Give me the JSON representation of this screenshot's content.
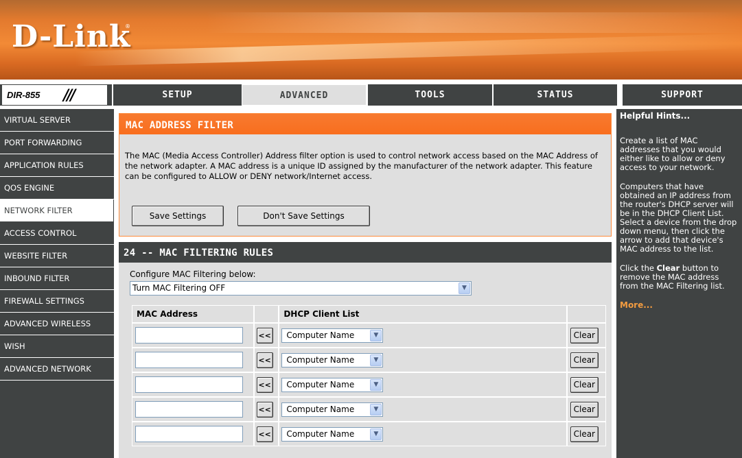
{
  "brand": {
    "logo": "D-Link",
    "registered_mark": "®",
    "model": "DIR-855",
    "model_slashes": "///"
  },
  "nav": {
    "tabs": [
      {
        "label": "SETUP"
      },
      {
        "label": "ADVANCED"
      },
      {
        "label": "TOOLS"
      },
      {
        "label": "STATUS"
      },
      {
        "label": "SUPPORT"
      }
    ],
    "active_tab": "ADVANCED"
  },
  "sidebar": {
    "items": [
      {
        "label": "VIRTUAL SERVER"
      },
      {
        "label": "PORT FORWARDING"
      },
      {
        "label": "APPLICATION RULES"
      },
      {
        "label": "QOS ENGINE"
      },
      {
        "label": "NETWORK FILTER"
      },
      {
        "label": "ACCESS CONTROL"
      },
      {
        "label": "WEBSITE FILTER"
      },
      {
        "label": "INBOUND FILTER"
      },
      {
        "label": "FIREWALL SETTINGS"
      },
      {
        "label": "ADVANCED WIRELESS"
      },
      {
        "label": "WISH"
      },
      {
        "label": "ADVANCED NETWORK"
      }
    ],
    "active_item": "NETWORK FILTER"
  },
  "filter": {
    "title": "MAC ADDRESS FILTER",
    "description": "The MAC (Media Access Controller) Address filter option is used to control network access based on the MAC Address of the network adapter. A MAC address is a unique ID assigned by the manufacturer of the network adapter. This feature can be configured to ALLOW or DENY network/Internet access.",
    "save_label": "Save Settings",
    "nosave_label": "Don't Save Settings"
  },
  "rules": {
    "title": "24 -- MAC FILTERING RULES",
    "config_label": "Configure MAC Filtering below:",
    "config_value": "Turn MAC Filtering OFF",
    "col_mac": "MAC Address",
    "col_dhcp": "DHCP Client List",
    "arrow_label": "<<",
    "client_value": "Computer Name",
    "clear_label": "Clear",
    "rows": [
      {
        "mac": ""
      },
      {
        "mac": ""
      },
      {
        "mac": ""
      },
      {
        "mac": ""
      },
      {
        "mac": ""
      }
    ]
  },
  "hints": {
    "title": "Helpful Hints...",
    "p1": "Create a list of MAC addresses that you would either like to allow or deny access to your network.",
    "p2": "Computers that have obtained an IP address from the router's DHCP server will be in the DHCP Client List. Select a device from the drop down menu, then click the arrow to add that device's MAC address to the list.",
    "p3_before": "Click the ",
    "p3_bold": "Clear",
    "p3_after": " button to remove the MAC address from the MAC Filtering list.",
    "more": "More..."
  },
  "icons": {
    "dropdown": "chevron-down-icon"
  },
  "colors": {
    "orange": "#f96e1e",
    "dark": "#404343",
    "panel": "#dfdfdf",
    "link": "#f39c40"
  }
}
